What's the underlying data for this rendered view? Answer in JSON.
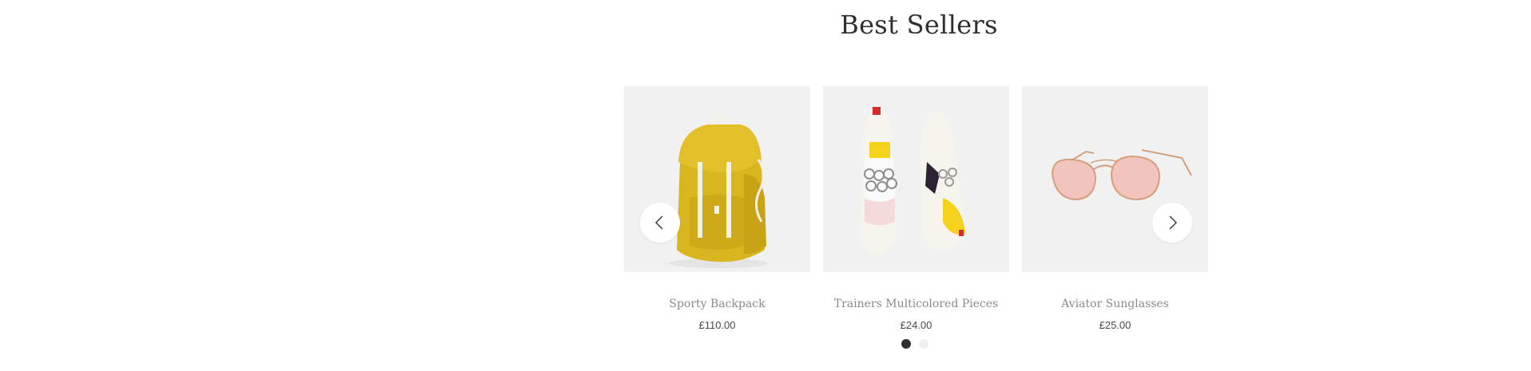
{
  "section": {
    "title": "Best Sellers"
  },
  "carousel": {
    "prev_icon": "chevron-left-icon",
    "next_icon": "chevron-right-icon",
    "active_page": 1,
    "page_count": 2,
    "products": [
      {
        "name": "Sporty Backpack",
        "price": "£110.00",
        "image": "yellow-backpack"
      },
      {
        "name": "Trainers Multicolored Pieces",
        "price": "£24.00",
        "image": "multicolored-trainers"
      },
      {
        "name": "Aviator Sunglasses",
        "price": "£25.00",
        "image": "pink-aviator-sunglasses"
      }
    ]
  },
  "colors": {
    "title": "#2f2f2f",
    "product_name": "#8a8a8a",
    "price": "#4a4a4a",
    "image_bg": "#f1f1f1",
    "dot_active": "#2f2f2f",
    "dot_inactive": "#efefef"
  }
}
